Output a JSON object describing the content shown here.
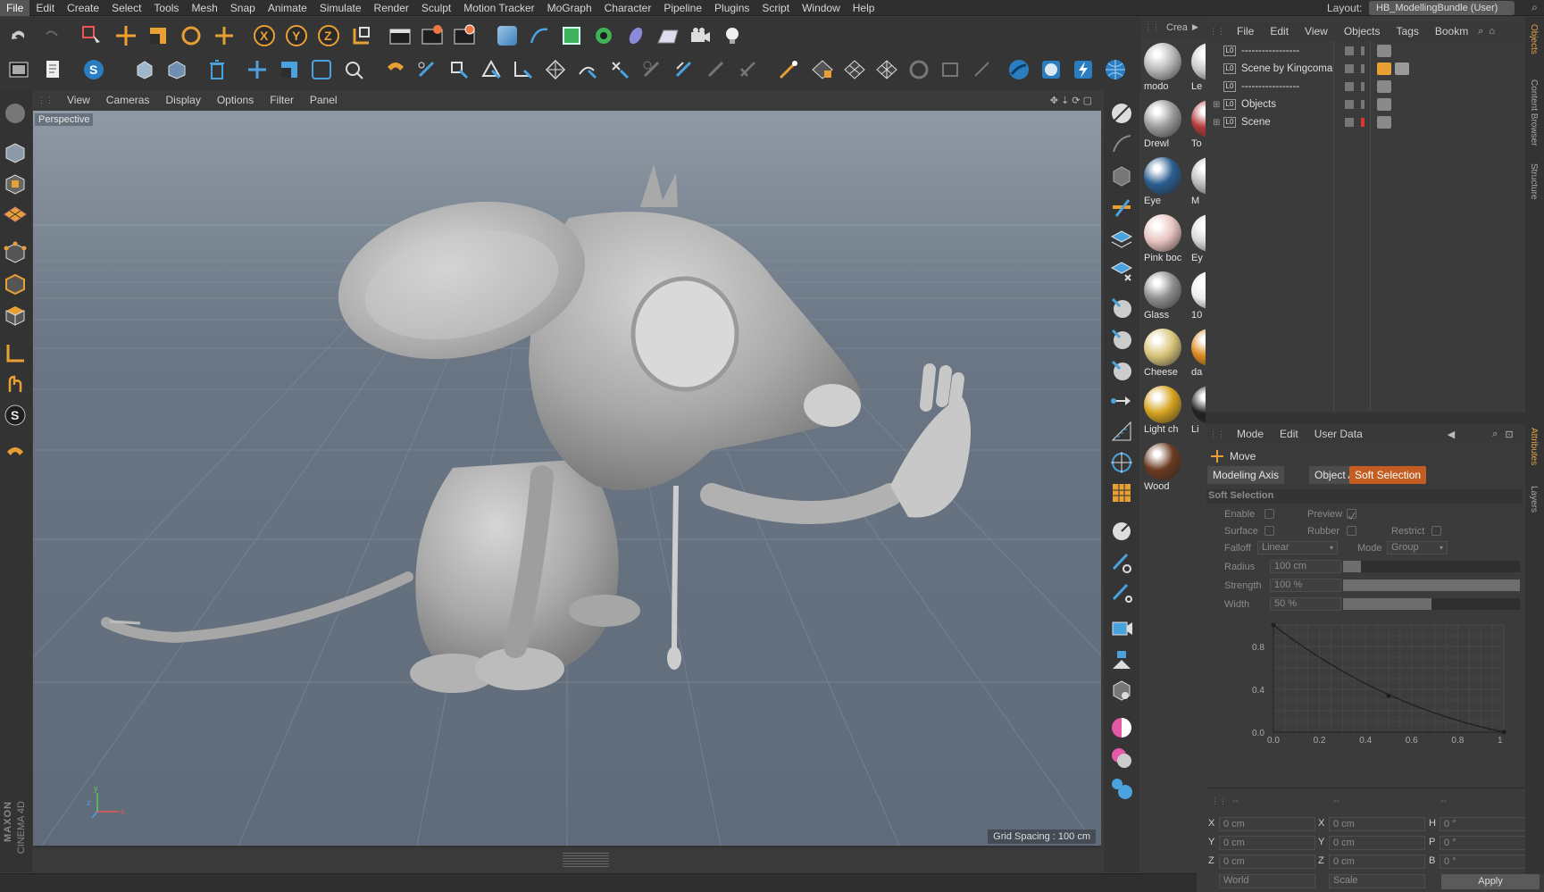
{
  "menubar": {
    "items": [
      "File",
      "Edit",
      "Create",
      "Select",
      "Tools",
      "Mesh",
      "Snap",
      "Animate",
      "Simulate",
      "Render",
      "Sculpt",
      "Motion Tracker",
      "MoGraph",
      "Character",
      "Pipeline",
      "Plugins",
      "Script",
      "Window",
      "Help"
    ],
    "layout_label": "Layout:",
    "layout_value": "HB_ModellingBundle (User)"
  },
  "viewport": {
    "menu": [
      "View",
      "Cameras",
      "Display",
      "Options",
      "Filter",
      "Panel"
    ],
    "label": "Perspective",
    "grid_spacing": "Grid Spacing : 100 cm"
  },
  "branding": {
    "vendor": "MAXON",
    "product": "CINEMA 4D"
  },
  "content_browser": {
    "title": "Crea"
  },
  "materials": [
    {
      "name": "modo",
      "color": "#b8b8b8"
    },
    {
      "name": "Drewl",
      "color": "#9a9a9a"
    },
    {
      "name": "Eye",
      "color": "#2a5d8f"
    },
    {
      "name": "Pink boc",
      "color": "#e8c3c0"
    },
    {
      "name": "Glass",
      "color": "#8e8e8e"
    },
    {
      "name": "Cheese",
      "color": "#d8c57a"
    },
    {
      "name": "Light ch",
      "color": "#d5a31f"
    },
    {
      "name": "Wood",
      "color": "#6b3a21"
    }
  ],
  "materials_col2": [
    {
      "name": "Le",
      "color": "#c9c9c9"
    },
    {
      "name": "To",
      "color": "#b33a3a"
    },
    {
      "name": "M",
      "color": "#bbbbbb"
    },
    {
      "name": "Ey",
      "color": "#d8d8d8"
    },
    {
      "name": "10",
      "color": "#ececec"
    },
    {
      "name": "da",
      "color": "#d88a1e"
    },
    {
      "name": "Li",
      "color": "#222222"
    }
  ],
  "objects_panel": {
    "menu": [
      "File",
      "Edit",
      "View",
      "Objects",
      "Tags",
      "Bookm"
    ],
    "rows": [
      {
        "name": "-----------------"
      },
      {
        "name": "Scene by Kingcoma"
      },
      {
        "name": "-----------------"
      },
      {
        "name": "Objects"
      },
      {
        "name": "Scene"
      }
    ],
    "lo": "L0"
  },
  "attributes": {
    "menu": [
      "Mode",
      "Edit",
      "User Data"
    ],
    "tool": "Move",
    "tabs": [
      "Modeling Axis",
      "Object Axis",
      "Soft Selection"
    ],
    "section": "Soft Selection",
    "enable": "Enable",
    "preview": "Preview",
    "surface": "Surface",
    "rubber": "Rubber",
    "restrict": "Restrict",
    "falloff": "Falloff",
    "falloff_value": "Linear",
    "mode": "Mode",
    "mode_value": "Group",
    "radius": "Radius",
    "radius_value": "100 cm",
    "strength": "Strength",
    "strength_value": "100 %",
    "width": "Width",
    "width_value": "50 %",
    "radius_fill": 0.1,
    "strength_fill": 1.0,
    "width_fill": 0.5
  },
  "chart_data": {
    "type": "line",
    "x": [
      0.0,
      0.5,
      1.0
    ],
    "y": [
      1.0,
      0.5,
      0.0
    ],
    "xticks": [
      "0.0",
      "0.2",
      "0.4",
      "0.6",
      "0.8",
      "1"
    ],
    "yticks": [
      "0.8",
      "0.4",
      "0.0"
    ],
    "xlim": [
      0,
      1
    ],
    "ylim": [
      0,
      1
    ],
    "grid": true
  },
  "coordinates": {
    "headers": [
      "--",
      "--",
      "--"
    ],
    "rows": [
      {
        "a": "X",
        "av": "0 cm",
        "b": "X",
        "bv": "0 cm",
        "c": "H",
        "cv": "0 °"
      },
      {
        "a": "Y",
        "av": "0 cm",
        "b": "Y",
        "bv": "0 cm",
        "c": "P",
        "cv": "0 °"
      },
      {
        "a": "Z",
        "av": "0 cm",
        "b": "Z",
        "bv": "0 cm",
        "c": "B",
        "cv": "0 °"
      }
    ],
    "space": "World",
    "mode": "Scale",
    "apply": "Apply"
  },
  "right_tabs": [
    "Objects",
    "Content Browser",
    "Structure",
    "Attributes",
    "Layers"
  ],
  "axis_labels": {
    "y": "y",
    "z": "z",
    "x": "x"
  }
}
